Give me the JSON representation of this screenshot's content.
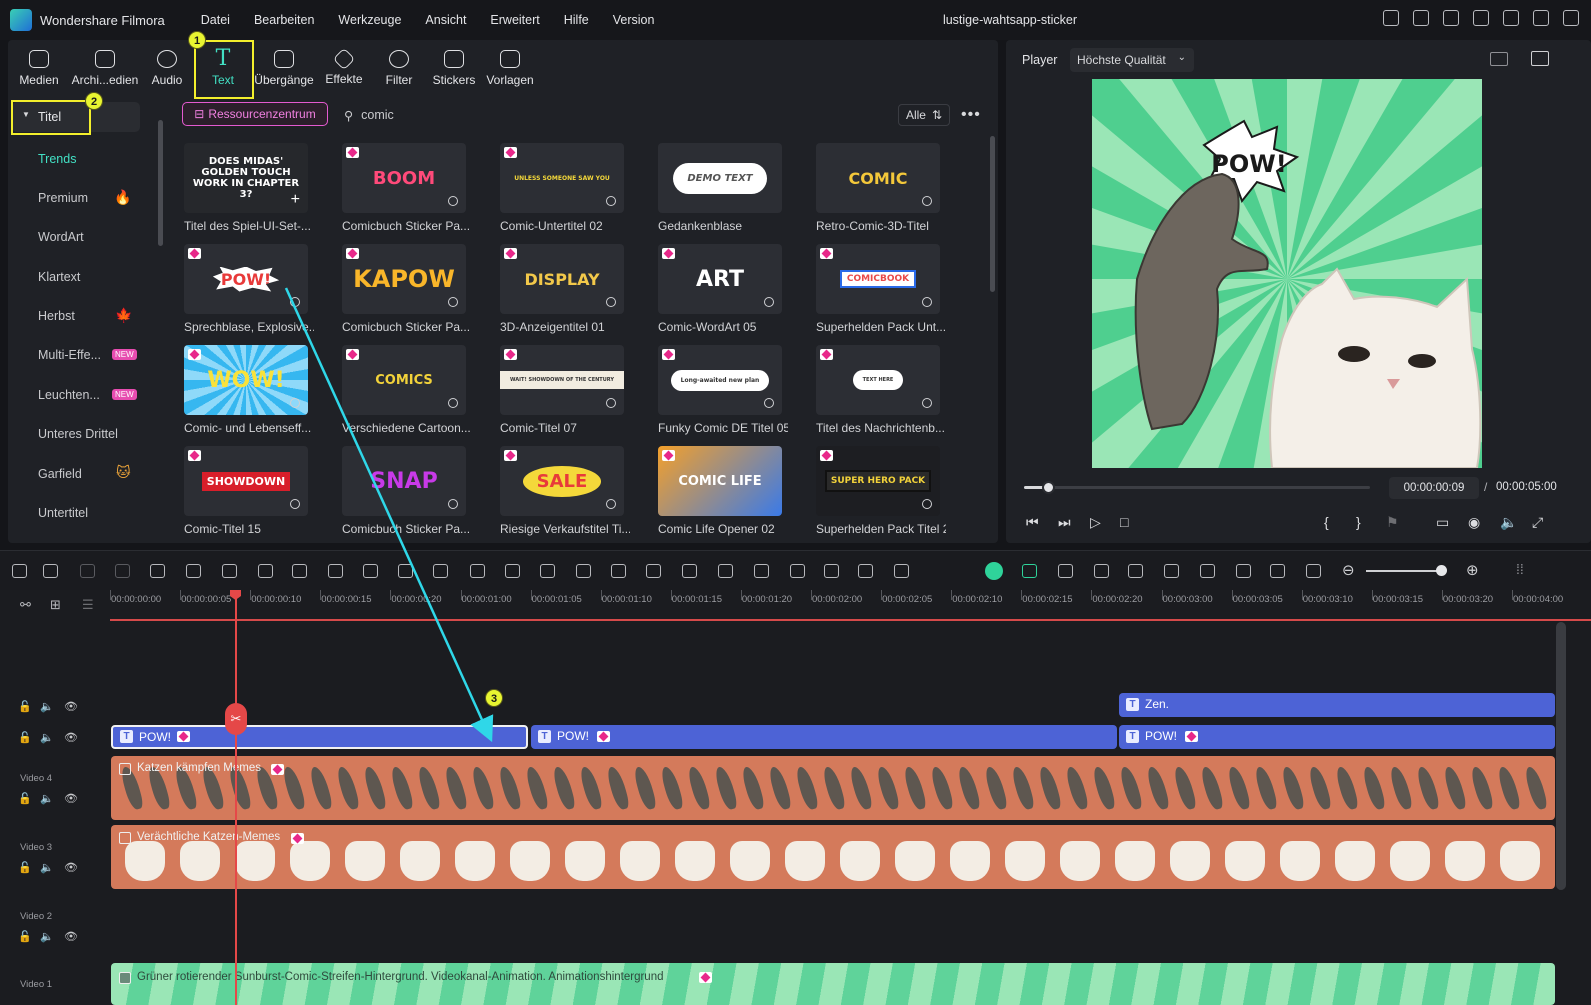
{
  "menubar": {
    "app_title": "Wondershare Filmora",
    "menus": [
      "Datei",
      "Bearbeiten",
      "Werkzeuge",
      "Ansicht",
      "Erweitert",
      "Hilfe",
      "Version"
    ],
    "document_title": "lustige-wahtsapp-sticker"
  },
  "toolbar": {
    "tabs": [
      {
        "label": "Medien",
        "icon": "media-icon"
      },
      {
        "label": "Archi...edien",
        "icon": "archive-icon"
      },
      {
        "label": "Audio",
        "icon": "music-note-icon"
      },
      {
        "label": "Text",
        "icon": "text-t-icon"
      },
      {
        "label": "Übergänge",
        "icon": "transition-icon"
      },
      {
        "label": "Effekte",
        "icon": "effects-icon"
      },
      {
        "label": "Filter",
        "icon": "filter-icon"
      },
      {
        "label": "Stickers",
        "icon": "sticker-icon"
      },
      {
        "label": "Vorlagen",
        "icon": "template-icon"
      }
    ],
    "active": "Text"
  },
  "steps": [
    "1",
    "2",
    "3"
  ],
  "categories": {
    "header": "Titel",
    "items": [
      "Trends",
      "Premium",
      "WordArt",
      "Klartext",
      "Herbst",
      "Multi-Effe...",
      "Leuchten...",
      "Unteres Drittel",
      "Garfield",
      "Untertitel"
    ],
    "new_badge": "NEW"
  },
  "search": {
    "resource_button": "Ressourcenzentrum",
    "query": "comic",
    "filter_label": "Alle"
  },
  "assets": [
    {
      "title": "Titel des Spiel-UI-Set-...",
      "art": "DOES MIDAS' GOLDEN TOUCH WORK IN CHAPTER 3?"
    },
    {
      "title": "Comicbuch Sticker Pa...",
      "art": "BOOM"
    },
    {
      "title": "Comic-Untertitel 02",
      "art": "UNLESS SOMEONE SAW YOU"
    },
    {
      "title": "Gedankenblase",
      "art": "DEMO TEXT"
    },
    {
      "title": "Retro-Comic-3D-Titel",
      "art": "COMIC"
    },
    {
      "title": "Sprechblase, Explosive...",
      "art": "POW!"
    },
    {
      "title": "Comicbuch Sticker Pa...",
      "art": "KAPOW"
    },
    {
      "title": "3D-Anzeigentitel 01",
      "art": "DISPLAY"
    },
    {
      "title": "Comic-WordArt 05",
      "art": "ART"
    },
    {
      "title": "Superhelden Pack Unt...",
      "art": "COMICBOOK"
    },
    {
      "title": "Comic- und Lebenseff...",
      "art": "WOW!"
    },
    {
      "title": "Verschiedene Cartoon...",
      "art": "COMICS"
    },
    {
      "title": "Comic-Titel 07",
      "art": "WAIT! SHOWDOWN OF THE CENTURY"
    },
    {
      "title": "Funky Comic DE Titel 05",
      "art": "Long-awaited new plan"
    },
    {
      "title": "Titel des Nachrichtenb...",
      "art": "TEXT HERE"
    },
    {
      "title": "Comic-Titel 15",
      "art": "SHOWDOWN"
    },
    {
      "title": "Comicbuch Sticker Pa...",
      "art": "SNAP"
    },
    {
      "title": "Riesige Verkaufstitel Ti...",
      "art": "SALE"
    },
    {
      "title": "Comic Life Opener 02",
      "art": "COMIC LIFE"
    },
    {
      "title": "Superhelden Pack Titel 2",
      "art": "SUPER HERO PACK"
    }
  ],
  "player": {
    "label": "Player",
    "quality": "Höchste Qualität",
    "preview_text": "POW!",
    "current_time": "00:00:00:09",
    "separator": "/",
    "total_time": "00:00:05:00",
    "progress_percent": 7
  },
  "timeline": {
    "ruler": [
      "00:00:00:00",
      "00:00:00:05",
      "00:00:00:10",
      "00:00:00:15",
      "00:00:00:20",
      "00:00:01:00",
      "00:00:01:05",
      "00:00:01:10",
      "00:00:01:15",
      "00:00:01:20",
      "00:00:02:00",
      "00:00:02:05",
      "00:00:02:10",
      "00:00:02:15",
      "00:00:02:20",
      "00:00:03:00",
      "00:00:03:05",
      "00:00:03:10",
      "00:00:03:15",
      "00:00:03:20",
      "00:00:04:00"
    ],
    "track_labels": [
      "Video 4",
      "Video 3",
      "Video 2",
      "Video 1"
    ],
    "clips": {
      "zen": "Zen.",
      "pow1": "POW!",
      "pow2": "POW!",
      "pow3": "POW!",
      "video4": "Katzen kämpfen Memes",
      "video3": "Verächtliche Katzen-Memes",
      "video1": "Grüner rotierender Sunburst-Comic-Streifen-Hintergrund. Videokanal-Animation. Animationshintergrund"
    }
  },
  "colors": {
    "accent": "#42e0c4",
    "highlight": "#f3ef2c",
    "text_clip": "#4d63d6",
    "video_clip": "#d47a5b",
    "playhead": "#e54848",
    "arrow": "#2fd7e8"
  }
}
